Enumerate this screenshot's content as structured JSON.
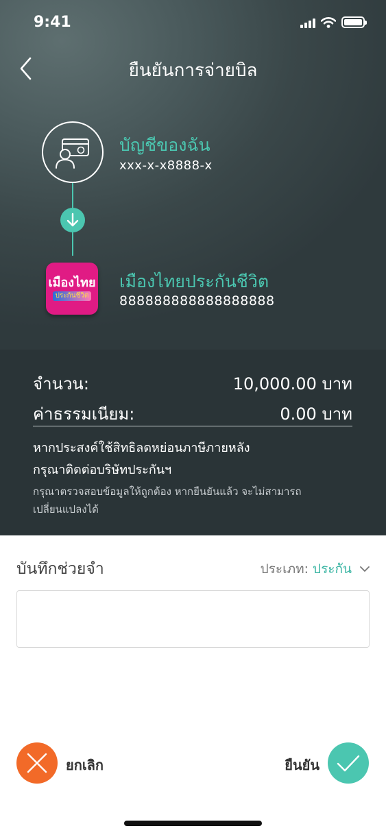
{
  "status_bar": {
    "time": "9:41"
  },
  "header": {
    "title": "ยืนยันการจ่ายบิล"
  },
  "from_account": {
    "name": "บัญชีของฉัน",
    "number": "xxx-x-x8888-x"
  },
  "to_biller": {
    "name": "เมืองไทยประกันชีวิต",
    "number": "888888888888888888",
    "logo_text_main": "เมืองไทย",
    "logo_text_sub": "ประกันชีวิต"
  },
  "summary": {
    "amount_label": "จำนวน:",
    "amount_value": "10,000.00 บาท",
    "fee_label": "ค่าธรรมเนียม:",
    "fee_value": "0.00 บาท",
    "note_line1": "หากประสงค์ใช้สิทธิลดหย่อนภาษีภายหลัง",
    "note_line2": "กรุณาติดต่อบริษัทประกันฯ",
    "note_line3": "กรุณาตรวจสอบข้อมูลให้ถูกต้อง หากยืนยันแล้ว จะไม่สามารถเปลี่ยนแปลงได้"
  },
  "memo": {
    "label": "บันทึกช่วยจำ",
    "type_label": "ประเภท:",
    "type_value": "ประกัน",
    "input_value": ""
  },
  "actions": {
    "cancel_label": "ยกเลิก",
    "confirm_label": "ยืนยัน"
  },
  "colors": {
    "accent": "#4bc6b0",
    "cancel": "#f26a28",
    "panel_dark": "#2a3437",
    "brand_pink": "#e01b84"
  },
  "icons": [
    "back-chevron-icon",
    "signal-icon",
    "wifi-icon",
    "battery-icon",
    "account-card-icon",
    "arrow-down-icon",
    "muang-thai-logo",
    "chevron-down-icon",
    "close-icon",
    "check-icon"
  ]
}
